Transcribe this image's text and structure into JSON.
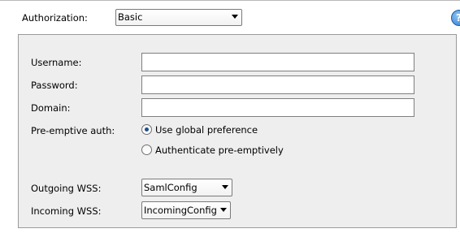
{
  "authorization": {
    "label": "Authorization:",
    "selected": "Basic"
  },
  "help": {
    "icon": "help-icon",
    "glyph": "?"
  },
  "credentials": {
    "username": {
      "label": "Username:",
      "value": ""
    },
    "password": {
      "label": "Password:",
      "value": ""
    },
    "domain": {
      "label": "Domain:",
      "value": ""
    }
  },
  "preemptive": {
    "label": "Pre-emptive auth:",
    "options": [
      {
        "label": "Use global preference",
        "selected": true
      },
      {
        "label": "Authenticate pre-emptively",
        "selected": false
      }
    ]
  },
  "wss": {
    "outgoing": {
      "label": "Outgoing WSS:",
      "selected": "SamlConfig"
    },
    "incoming": {
      "label": "Incoming WSS:",
      "selected": "IncomingConfig"
    }
  }
}
